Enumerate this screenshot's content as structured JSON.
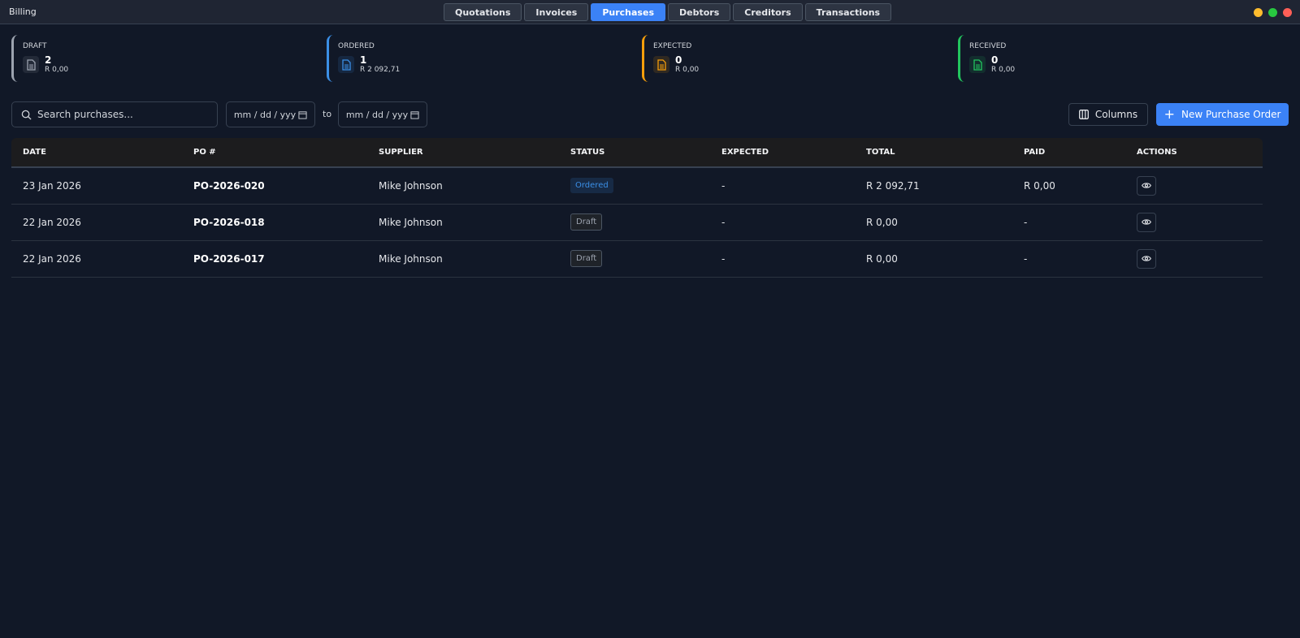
{
  "app": {
    "title": "Billing"
  },
  "tabs": [
    {
      "label": "Quotations"
    },
    {
      "label": "Invoices"
    },
    {
      "label": "Purchases",
      "active": true
    },
    {
      "label": "Debtors"
    },
    {
      "label": "Creditors"
    },
    {
      "label": "Transactions"
    }
  ],
  "window_controls": {
    "minimize": "#febc2e",
    "maximize": "#28c840",
    "close": "#ff5f57"
  },
  "stats": [
    {
      "label": "DRAFT",
      "count": "2",
      "amount": "R 0,00",
      "color": "#9ca3af",
      "icon": "document-icon"
    },
    {
      "label": "ORDERED",
      "count": "1",
      "amount": "R 2 092,71",
      "color": "#3b8fe6",
      "icon": "document-icon"
    },
    {
      "label": "EXPECTED",
      "count": "0",
      "amount": "R 0,00",
      "color": "#f59e0b",
      "icon": "document-icon"
    },
    {
      "label": "RECEIVED",
      "count": "0",
      "amount": "R 0,00",
      "color": "#22c55e",
      "icon": "document-icon"
    }
  ],
  "filters": {
    "search_placeholder": "Search purchases...",
    "date_from": "mm / dd / yyy",
    "date_to": "mm / dd / yyy",
    "to_label": "to",
    "columns_label": "Columns",
    "new_label": "New Purchase Order"
  },
  "table": {
    "headers": [
      "DATE",
      "PO #",
      "SUPPLIER",
      "STATUS",
      "EXPECTED",
      "TOTAL",
      "PAID",
      "ACTIONS"
    ],
    "rows": [
      {
        "date": "23 Jan 2026",
        "po": "PO-2026-020",
        "supplier": "Mike Johnson",
        "status": "Ordered",
        "expected": "-",
        "total": "R 2 092,71",
        "paid": "R 0,00"
      },
      {
        "date": "22 Jan 2026",
        "po": "PO-2026-018",
        "supplier": "Mike Johnson",
        "status": "Draft",
        "expected": "-",
        "total": "R 0,00",
        "paid": "-"
      },
      {
        "date": "22 Jan 2026",
        "po": "PO-2026-017",
        "supplier": "Mike Johnson",
        "status": "Draft",
        "expected": "-",
        "total": "R 0,00",
        "paid": "-"
      }
    ]
  }
}
